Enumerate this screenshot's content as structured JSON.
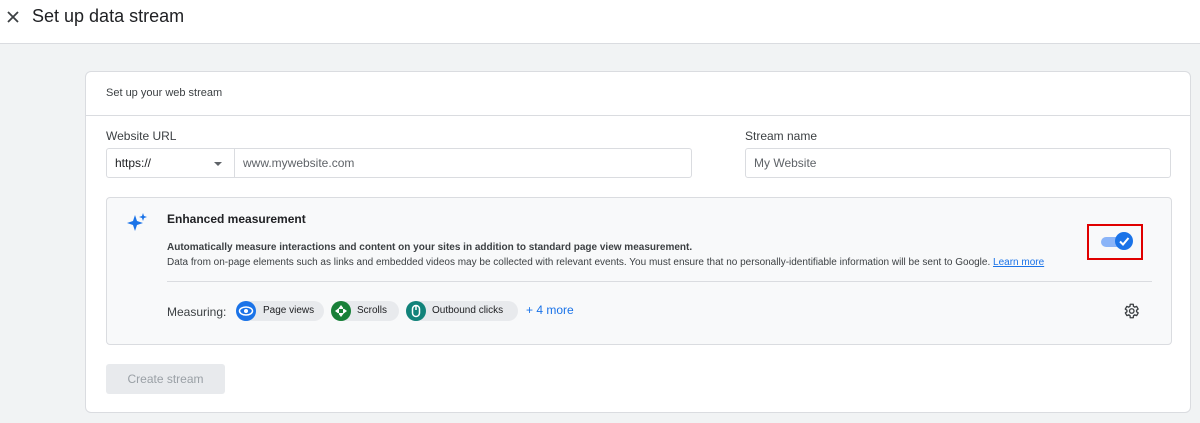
{
  "header": {
    "title": "Set up data stream",
    "close_icon": "close-icon"
  },
  "card": {
    "heading": "Set up your web stream",
    "website_url": {
      "label": "Website URL",
      "protocol_value": "https://",
      "url_placeholder": "www.mywebsite.com"
    },
    "stream_name": {
      "label": "Stream name",
      "placeholder": "My Website"
    },
    "enhanced_measurement": {
      "icon": "sparkle-icon",
      "title": "Enhanced measurement",
      "description_bold": "Automatically measure interactions and content on your sites in addition to standard page view measurement.",
      "description": "Data from on-page elements such as links and embedded videos may be collected with relevant events. You must ensure that no personally-identifiable information will be sent to Google.",
      "learn_more": "Learn more",
      "toggle_on": true,
      "measuring_label": "Measuring:",
      "chips": [
        {
          "label": "Page views",
          "icon": "eye-icon",
          "color": "#1a73e8"
        },
        {
          "label": "Scrolls",
          "icon": "scroll-icon",
          "color": "#188038"
        },
        {
          "label": "Outbound clicks",
          "icon": "mouse-icon",
          "color": "#12837a"
        }
      ],
      "more_link": "+ 4 more",
      "settings_icon": "gear-icon"
    },
    "create_button": "Create stream"
  },
  "colors": {
    "accent": "#1a73e8",
    "highlight_border": "#e00000"
  }
}
